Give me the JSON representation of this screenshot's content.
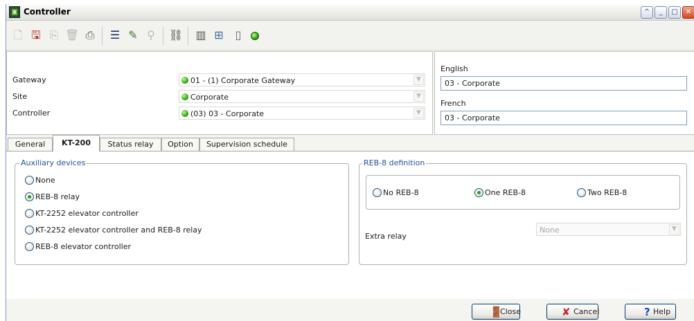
{
  "window": {
    "title": "Controller"
  },
  "titlebar_buttons": {
    "help": "^",
    "minimize": "_",
    "maximize": "□",
    "close": "✕"
  },
  "toolbar": {
    "icons": [
      "new-icon",
      "save-icon",
      "copy-icon",
      "delete-icon",
      "print-icon",
      "list-icon",
      "edit-icon",
      "find-icon",
      "link-icon",
      "door-icon",
      "network-icon",
      "device-icon",
      "status-icon"
    ]
  },
  "header": {
    "gateway_label": "Gateway",
    "gateway_value": "01 - (1)  Corporate Gateway",
    "site_label": "Site",
    "site_value": "Corporate",
    "controller_label": "Controller",
    "controller_value": "(03) 03 - Corporate",
    "status_color": "#2fa60d"
  },
  "languages": {
    "english_label": "English",
    "english_value": "03 - Corporate",
    "french_label": "French",
    "french_value": "03 - Corporate"
  },
  "tabs": [
    {
      "label": "General",
      "active": false
    },
    {
      "label": "KT-200",
      "active": true
    },
    {
      "label": "Status relay",
      "active": false
    },
    {
      "label": "Option",
      "active": false
    },
    {
      "label": "Supervision schedule",
      "active": false
    }
  ],
  "auxiliary": {
    "title": "Auxiliary devices",
    "options": [
      {
        "label": "None",
        "checked": false
      },
      {
        "label": "REB-8 relay",
        "checked": true
      },
      {
        "label": "KT-2252 elevator controller",
        "checked": false
      },
      {
        "label": "KT-2252 elevator controller and REB-8 relay",
        "checked": false
      },
      {
        "label": "REB-8 elevator controller",
        "checked": false
      }
    ]
  },
  "reb8": {
    "title": "REB-8 definition",
    "options": [
      {
        "label": "No REB-8",
        "checked": false
      },
      {
        "label": "One REB-8",
        "checked": true
      },
      {
        "label": "Two REB-8",
        "checked": false
      }
    ],
    "extra_relay_label": "Extra relay",
    "extra_relay_value": "None"
  },
  "buttons": {
    "close": "Close",
    "cancel": "Cancel",
    "help": "Help"
  },
  "colors": {
    "accent_title": "#1f4fa8",
    "cancel_icon": "#c1272d",
    "help_icon": "#1b4fb5"
  }
}
